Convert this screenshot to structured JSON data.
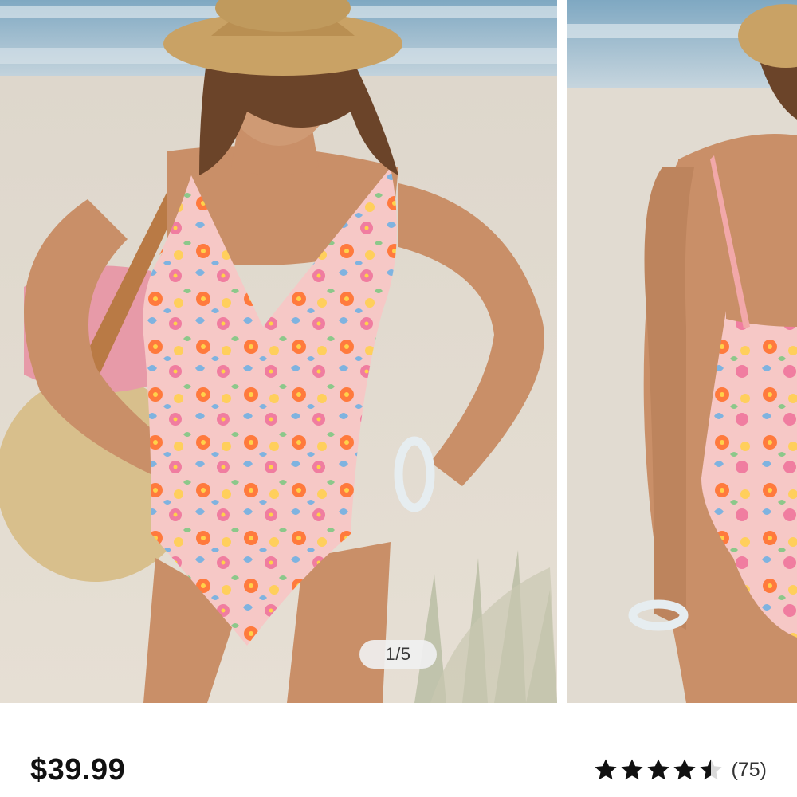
{
  "gallery": {
    "slides": [
      {
        "alt": "swimsuit-front-view-image"
      },
      {
        "alt": "swimsuit-back-view-image"
      }
    ],
    "pager_text": "1/5"
  },
  "product": {
    "price": "$39.99",
    "rating_value": 4.5,
    "rating_max": 5,
    "review_count": "(75)"
  },
  "colors": {
    "price_text": "#111111",
    "star_fill": "#111111",
    "star_empty": "#d9d9d9",
    "pager_bg": "#f0f0f0"
  },
  "icons": {
    "star": "star-icon",
    "half_star": "half-star-icon"
  }
}
